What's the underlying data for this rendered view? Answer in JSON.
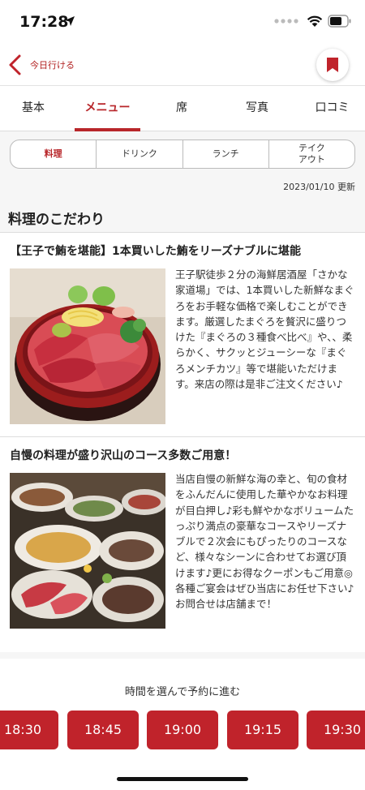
{
  "status_bar": {
    "time": "17:28"
  },
  "nav": {
    "back_label": "今日行ける"
  },
  "tabs": [
    "基本",
    "メニュー",
    "席",
    "写真",
    "口コミ"
  ],
  "segments": [
    "料理",
    "ドリンク",
    "ランチ",
    "テイク\nアウト"
  ],
  "updated": "2023/01/10 更新",
  "section_title": "料理のこだわり",
  "cards": [
    {
      "title": "【王子で鮪を堪能】1本買いした鮪をリーズナブルに堪能",
      "text": "王子駅徒歩２分の海鮮居酒屋「さかな家道場」では、1本買いした新鮮なまぐろをお手軽な価格で楽しむことができます。厳選したまぐろを贅沢に盛りつけた『まぐろの３種食べ比べ』や、、柔らかく、サクッとジューシーな『まぐろメンチカツ』等で堪能いただけます。来店の際は是非ご注文ください♪"
    },
    {
      "title": "自慢の料理が盛り沢山のコース多数ご用意！",
      "text": "当店自慢の新鮮な海の幸と、旬の食材をふんだんに使用した華やかなお料理が目白押し♪彩も鮮やかなボリュームたっぷり満点の豪華なコースやリーズナブルで２次会にもぴったりのコースなど、様々なシーンに合わせてお選び頂けます♪更にお得なクーポンもご用意◎各種ご宴会はぜひ当店にお任せ下さい♪お問合せは店舗まで！"
    }
  ],
  "reserve": {
    "cta": "時間を選んで予約に進む",
    "slots": [
      "18:30",
      "18:45",
      "19:00",
      "19:15",
      "19:30"
    ]
  },
  "colors": {
    "accent": "#c0232b"
  }
}
